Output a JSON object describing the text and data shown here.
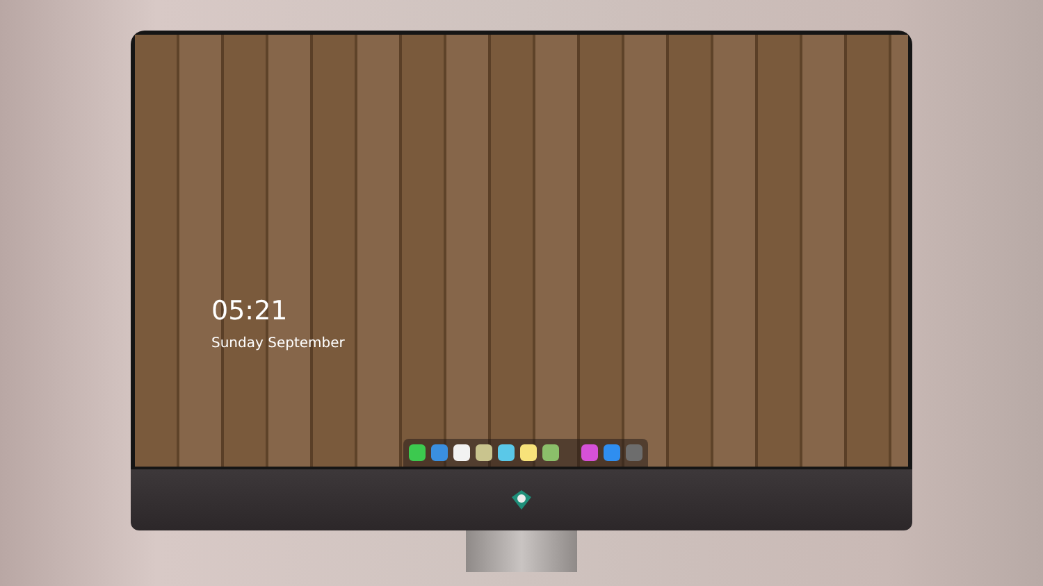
{
  "lock_screen": {
    "time": "05:21",
    "date": "Sunday September"
  }
}
